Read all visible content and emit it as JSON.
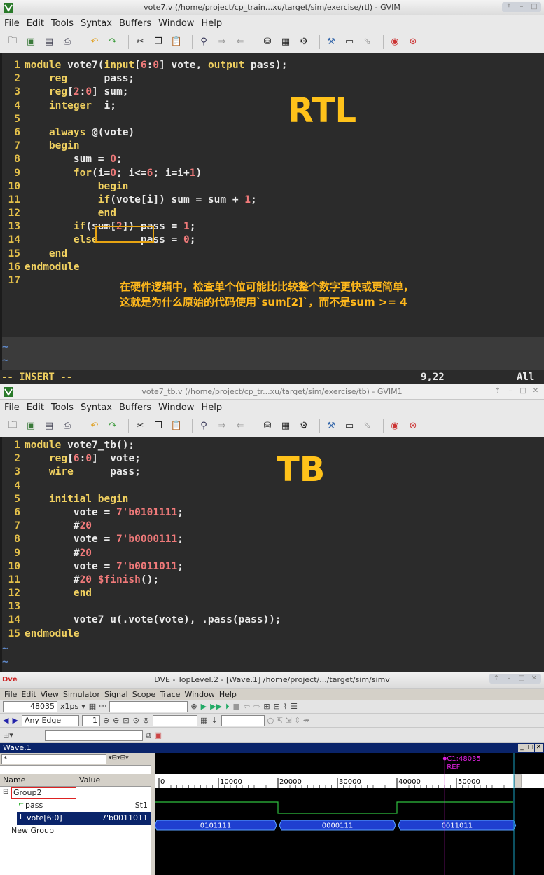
{
  "rtl_window": {
    "title": "vote7.v (/home/project/cp_train...xu/target/sim/exercise/rtl) - GVIM",
    "menu": [
      "File",
      "Edit",
      "Tools",
      "Syntax",
      "Buffers",
      "Window",
      "Help"
    ],
    "big_label": "RTL",
    "annotation_line1": "在硬件逻辑中，检查单个位可能比比较整个数字更快或更简单，",
    "annotation_line2": "这就是为什么原始的代码使用`sum[2]`，而不是sum >= 4",
    "mode": "-- INSERT --",
    "cursor_pos": "9,22",
    "scroll_pos": "All",
    "lines": [
      {
        "n": "1",
        "t": "module vote7(input[6:0] vote, output pass);"
      },
      {
        "n": "2",
        "t": "    reg      pass;"
      },
      {
        "n": "3",
        "t": "    reg[2:0] sum;"
      },
      {
        "n": "4",
        "t": "    integer  i;"
      },
      {
        "n": "5",
        "t": ""
      },
      {
        "n": "6",
        "t": "    always @(vote)"
      },
      {
        "n": "7",
        "t": "    begin"
      },
      {
        "n": "8",
        "t": "        sum = 0;"
      },
      {
        "n": "9",
        "t": "        for(i=0; i<=6; i=i+1)"
      },
      {
        "n": "10",
        "t": "            begin"
      },
      {
        "n": "11",
        "t": "            if(vote[i]) sum = sum + 1;"
      },
      {
        "n": "12",
        "t": "            end"
      },
      {
        "n": "13",
        "t": "        if(sum[2]) pass = 1;"
      },
      {
        "n": "14",
        "t": "        else       pass = 0;"
      },
      {
        "n": "15",
        "t": "    end"
      },
      {
        "n": "16",
        "t": "endmodule"
      },
      {
        "n": "17",
        "t": ""
      }
    ]
  },
  "tb_window": {
    "title": "vote7_tb.v (/home/project/cp_tr...xu/target/sim/exercise/tb) - GVIM1",
    "menu": [
      "File",
      "Edit",
      "Tools",
      "Syntax",
      "Buffers",
      "Window",
      "Help"
    ],
    "big_label": "TB",
    "lines": [
      {
        "n": "1",
        "t": "module vote7_tb();"
      },
      {
        "n": "2",
        "t": "    reg[6:0]  vote;"
      },
      {
        "n": "3",
        "t": "    wire      pass;"
      },
      {
        "n": "4",
        "t": ""
      },
      {
        "n": "5",
        "t": "    initial begin"
      },
      {
        "n": "6",
        "t": "        vote = 7'b0101111;"
      },
      {
        "n": "7",
        "t": "        #20"
      },
      {
        "n": "8",
        "t": "        vote = 7'b0000111;"
      },
      {
        "n": "9",
        "t": "        #20"
      },
      {
        "n": "10",
        "t": "        vote = 7'b0011011;"
      },
      {
        "n": "11",
        "t": "        #20 $finish();"
      },
      {
        "n": "12",
        "t": "        end"
      },
      {
        "n": "13",
        "t": ""
      },
      {
        "n": "14",
        "t": "        vote7 u(.vote(vote), .pass(pass));"
      },
      {
        "n": "15",
        "t": "endmodule"
      }
    ]
  },
  "dve_window": {
    "title": "DVE - TopLevel.2 - [Wave.1]  /home/project/.../target/sim/simv",
    "menu": [
      "File",
      "Edit",
      "View",
      "Simulator",
      "Signal",
      "Scope",
      "Trace",
      "Window",
      "Help"
    ],
    "time_value": "48035",
    "time_unit": "x1ps",
    "edge_select": "Any Edge",
    "edge_count": "1",
    "wave_tab": "Wave.1",
    "filter": "*",
    "col_name": "Name",
    "col_value": "Value",
    "group2": "Group2",
    "sig_pass": "pass",
    "sig_pass_value": "St1",
    "sig_vote": "vote[6:0]",
    "sig_vote_value": "7'b0011011",
    "new_group": "New Group",
    "cursor_label": "C1:48035",
    "ref_label": "REF",
    "ticks": [
      "0",
      "10000",
      "20000",
      "30000",
      "40000",
      "50000"
    ],
    "vote_segments": [
      "0101111",
      "0000111",
      "0011011"
    ]
  }
}
